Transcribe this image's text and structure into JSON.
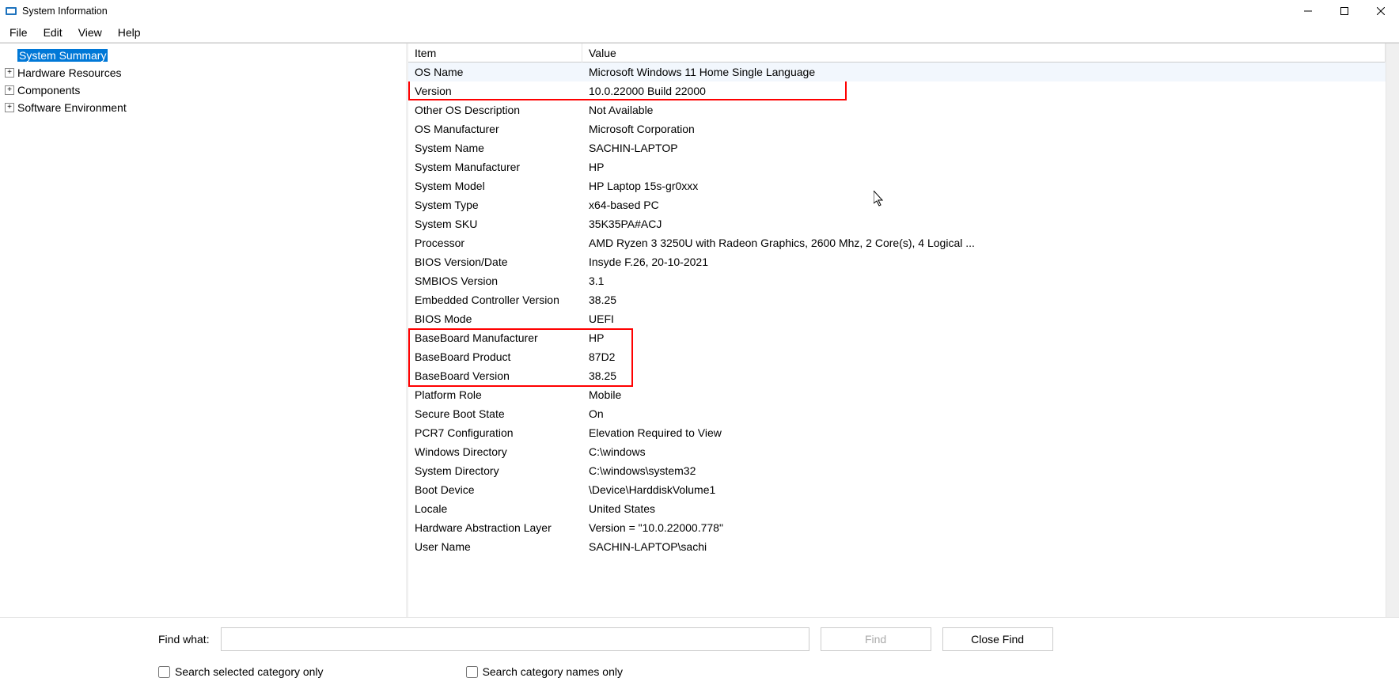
{
  "window_title": "System Information",
  "menu": {
    "file": "File",
    "edit": "Edit",
    "view": "View",
    "help": "Help"
  },
  "tree": {
    "summary": "System Summary",
    "hardware": "Hardware Resources",
    "components": "Components",
    "software": "Software Environment"
  },
  "columns": {
    "item": "Item",
    "value": "Value"
  },
  "rows": [
    {
      "item": "OS Name",
      "value": "Microsoft Windows 11 Home Single Language"
    },
    {
      "item": "Version",
      "value": "10.0.22000 Build 22000"
    },
    {
      "item": "Other OS Description",
      "value": "Not Available"
    },
    {
      "item": "OS Manufacturer",
      "value": "Microsoft Corporation"
    },
    {
      "item": "System Name",
      "value": "SACHIN-LAPTOP"
    },
    {
      "item": "System Manufacturer",
      "value": "HP"
    },
    {
      "item": "System Model",
      "value": "HP Laptop 15s-gr0xxx"
    },
    {
      "item": "System Type",
      "value": "x64-based PC"
    },
    {
      "item": "System SKU",
      "value": "35K35PA#ACJ"
    },
    {
      "item": "Processor",
      "value": "AMD Ryzen 3 3250U with Radeon Graphics, 2600 Mhz, 2 Core(s), 4 Logical ..."
    },
    {
      "item": "BIOS Version/Date",
      "value": "Insyde F.26, 20-10-2021"
    },
    {
      "item": "SMBIOS Version",
      "value": "3.1"
    },
    {
      "item": "Embedded Controller Version",
      "value": "38.25"
    },
    {
      "item": "BIOS Mode",
      "value": "UEFI"
    },
    {
      "item": "BaseBoard Manufacturer",
      "value": "HP"
    },
    {
      "item": "BaseBoard Product",
      "value": "87D2"
    },
    {
      "item": "BaseBoard Version",
      "value": "38.25"
    },
    {
      "item": "Platform Role",
      "value": "Mobile"
    },
    {
      "item": "Secure Boot State",
      "value": "On"
    },
    {
      "item": "PCR7 Configuration",
      "value": "Elevation Required to View"
    },
    {
      "item": "Windows Directory",
      "value": "C:\\windows"
    },
    {
      "item": "System Directory",
      "value": "C:\\windows\\system32"
    },
    {
      "item": "Boot Device",
      "value": "\\Device\\HarddiskVolume1"
    },
    {
      "item": "Locale",
      "value": "United States"
    },
    {
      "item": "Hardware Abstraction Layer",
      "value": "Version = \"10.0.22000.778\""
    },
    {
      "item": "User Name",
      "value": "SACHIN-LAPTOP\\sachi"
    }
  ],
  "find_bar": {
    "label": "Find what:",
    "find_btn": "Find",
    "close_btn": "Close Find",
    "check_selected": "Search selected category only",
    "check_names": "Search category names only"
  }
}
